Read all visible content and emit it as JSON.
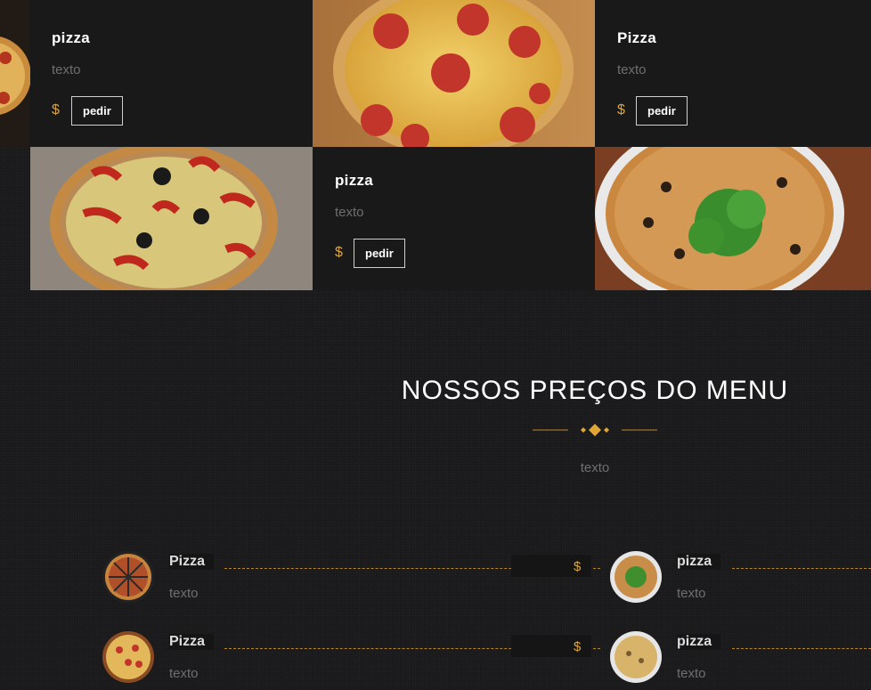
{
  "top_cards": [
    {
      "title": "pizza",
      "text": "texto",
      "currency": "$",
      "button": "pedir"
    },
    {
      "title": "Pizza",
      "text": "texto",
      "currency": "$",
      "button": "pedir"
    },
    {
      "title": "pizza",
      "text": "texto",
      "currency": "$",
      "button": "pedir"
    }
  ],
  "section": {
    "title": "NOSSOS PREÇOS DO MENU",
    "subtitle": "texto"
  },
  "menu_items": [
    {
      "name": "Pizza",
      "text": "texto",
      "currency": "$"
    },
    {
      "name": "pizza",
      "text": "texto",
      "currency": ""
    },
    {
      "name": "Pizza",
      "text": "texto",
      "currency": "$"
    },
    {
      "name": "pizza",
      "text": "texto",
      "currency": ""
    }
  ],
  "colors": {
    "accent": "#e0a536",
    "background": "#1a1a1b",
    "muted_text": "#6f6f6f"
  }
}
